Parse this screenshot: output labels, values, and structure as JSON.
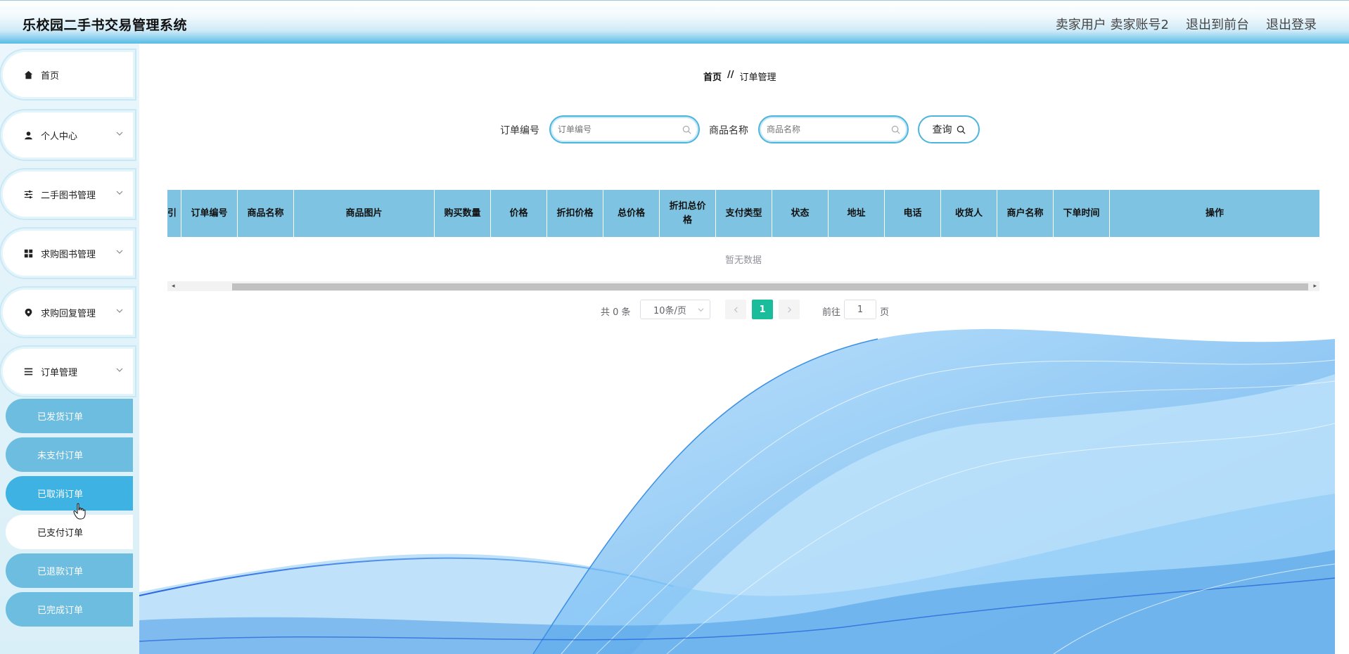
{
  "header": {
    "title": "乐校园二手书交易管理系统",
    "user_role": "卖家用户",
    "user_name": "卖家账号2",
    "to_front": "退出到前台",
    "logout": "退出登录"
  },
  "sidebar": {
    "items": [
      {
        "label": "首页",
        "icon": "home-icon"
      },
      {
        "label": "个人中心",
        "icon": "user-icon"
      },
      {
        "label": "二手图书管理",
        "icon": "sliders-icon"
      },
      {
        "label": "求购图书管理",
        "icon": "grid-icon"
      },
      {
        "label": "求购回复管理",
        "icon": "location-pin-icon"
      },
      {
        "label": "订单管理",
        "icon": "menu-icon"
      }
    ],
    "sub_items": [
      {
        "label": "已发货订单"
      },
      {
        "label": "未支付订单"
      },
      {
        "label": "已取消订单"
      },
      {
        "label": "已支付订单"
      },
      {
        "label": "已退款订单"
      },
      {
        "label": "已完成订单"
      }
    ],
    "hovered_sub": "已取消订单",
    "active_sub": "已支付订单"
  },
  "breadcrumb": {
    "home": "首页",
    "separator": "//",
    "current": "订单管理"
  },
  "search": {
    "order_no_label": "订单编号",
    "order_no_placeholder": "订单编号",
    "product_label": "商品名称",
    "product_placeholder": "商品名称",
    "query_button": "查询"
  },
  "table": {
    "columns": [
      "引",
      "订单编号",
      "商品名称",
      "商品图片",
      "购买数量",
      "价格",
      "折扣价格",
      "总价格",
      "折扣总价格",
      "支付类型",
      "状态",
      "地址",
      "电话",
      "收货人",
      "商户名称",
      "下单时间",
      "操作"
    ],
    "empty_text": "暂无数据"
  },
  "pagination": {
    "total": "共 0 条",
    "page_size": "10条/页",
    "current_page": "1",
    "goto_label": "前往",
    "goto_value": "1",
    "page_suffix": "页"
  },
  "colors": {
    "accent": "#4cb5de",
    "header_bottom": "#58bce6",
    "table_header": "#7ec4e2",
    "pager_active": "#1abc9c",
    "sub_item": "#6dbde0"
  }
}
